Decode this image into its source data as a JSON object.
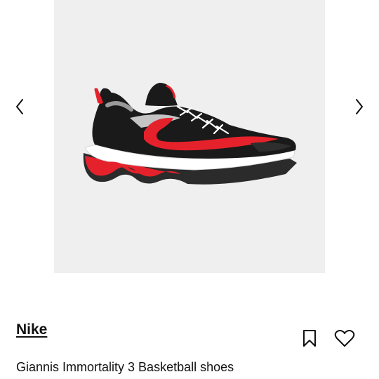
{
  "product": {
    "brand": "Nike",
    "name": "Giannis Immortality 3 Basketball shoes"
  },
  "icons": {
    "prev": "chevron-left-icon",
    "next": "chevron-right-icon",
    "save": "bookmark-icon",
    "wishlist": "heart-icon"
  },
  "colors": {
    "image_background": "#efefef",
    "shoe_upper": "#1a1a1a",
    "shoe_accent": "#e5222b",
    "sole": "#ffffff",
    "text": "#111111"
  }
}
